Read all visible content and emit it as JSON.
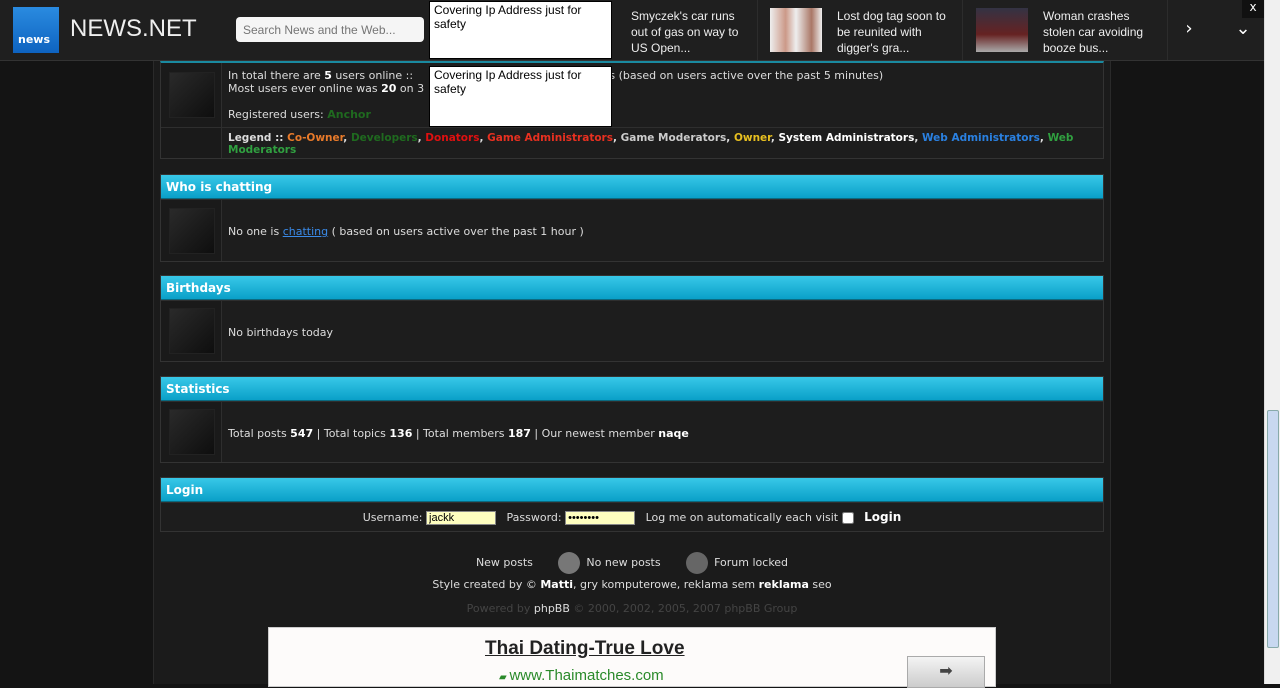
{
  "topbar": {
    "brand": "NEWS.NET",
    "logo_text": "news",
    "search_placeholder": "Search News and the Web...",
    "cover_text": "Covering Ip Address just for safety",
    "close": "x",
    "news": [
      {
        "title": "Smyczek's car runs out of gas on way to US Open..."
      },
      {
        "title": "Lost dog tag soon to be reunited with digger's gra..."
      },
      {
        "title": "Woman crashes stolen car avoiding booze bus..."
      }
    ]
  },
  "online": {
    "line1_a": "In total there are ",
    "users": "5",
    "line1_b": " users online :: ",
    "line1_c": "ests (based on users active over the past 5 minutes)",
    "line2_a": "Most users ever online was ",
    "most": "20",
    "line2_b": " on 3",
    "registered_label": "Registered users: ",
    "registered_user": "Anchor",
    "legend_label": "Legend :: ",
    "legend": [
      {
        "name": "Co-Owner",
        "color": "#e87a2a"
      },
      {
        "name": "Developers",
        "color": "#1f6a1f"
      },
      {
        "name": "Donators",
        "color": "#e01010"
      },
      {
        "name": "Game Administrators",
        "color": "#e83020"
      },
      {
        "name": "Game Moderators",
        "color": "#cccccc"
      },
      {
        "name": "Owner",
        "color": "#e8c020"
      },
      {
        "name": "System Administrators",
        "color": "#ffffff"
      },
      {
        "name": "Web Administrators",
        "color": "#2a80e0"
      },
      {
        "name": "Web Moderators",
        "color": "#30a040"
      }
    ]
  },
  "chatting": {
    "title": "Who is chatting",
    "text_a": "No one is ",
    "link": "chatting",
    "text_b": " ( based on users active over the past 1 hour )"
  },
  "birthdays": {
    "title": "Birthdays",
    "text": "No birthdays today"
  },
  "statistics": {
    "title": "Statistics",
    "a": "Total posts ",
    "posts": "547",
    "b": " | Total topics ",
    "topics": "136",
    "c": " | Total members ",
    "members": "187",
    "d": " | Our newest member ",
    "newest": "naqe"
  },
  "login": {
    "title": "Login",
    "username_label": "Username:",
    "username": "jackk",
    "password_label": "Password:",
    "password": "********",
    "auto_label": "Log me on automatically each visit",
    "button": "Login"
  },
  "footer": {
    "new_posts": "New posts",
    "no_new_posts": "No new posts",
    "forum_locked": "Forum locked",
    "style_a": "Style created by © ",
    "style_author": "Matti",
    "style_b": ", gry komputerowe, reklama sem ",
    "style_c": "reklama",
    "style_d": " seo",
    "powered_a": "Powered by ",
    "powered_link": "phpBB",
    "powered_b": " © 2000, 2002, 2005, 2007 phpBB Group"
  },
  "ad": {
    "title": "Thai Dating-True Love",
    "url": "www.Thaimatches.com"
  }
}
